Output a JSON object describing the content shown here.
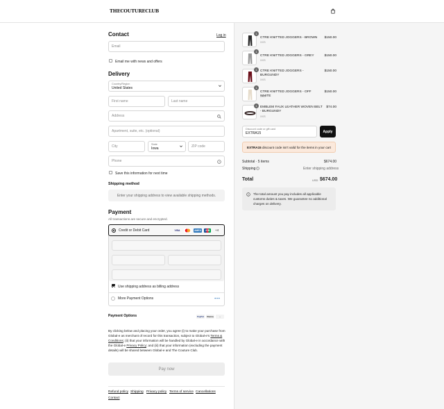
{
  "header": {
    "logo": "THECOUTURECLUB",
    "cart_icon": "shopping-bag-icon"
  },
  "contact": {
    "title": "Contact",
    "login_link": "Log in",
    "email_placeholder": "Email",
    "news_label": "Email me with news and offers"
  },
  "delivery": {
    "title": "Delivery",
    "country_label": "Country/Region",
    "country_value": "United States",
    "first_name": "First name",
    "last_name": "Last name",
    "address": "Address",
    "apartment": "Apartment, suite, etc. (optional)",
    "city": "City",
    "state_label": "State",
    "state_value": "Iowa",
    "zip": "ZIP code",
    "phone": "Phone",
    "save_label": "Save this information for next time"
  },
  "shipping": {
    "title": "Shipping method",
    "notice": "Enter your shipping address to view available shipping methods."
  },
  "payment": {
    "title": "Payment",
    "subtitle": "All transactions are secure and encrypted.",
    "card_label": "Credit or Debit Card",
    "card_logos": [
      "VISA",
      "MC",
      "AMEX",
      "JCB"
    ],
    "more_cards": "+4",
    "billing_label": "Use shipping address as billing address",
    "more_options_label": "More Payment Options",
    "options_title": "Payment Options",
    "option_badges": [
      "PayPal",
      "Klarna",
      "..."
    ]
  },
  "legal": {
    "line1": "By clicking below and placing your order, you agree (i) to make your purchase from",
    "line2a": "Global-e as merchant of record for this transaction, subject to Global-e's ",
    "terms": "Terms &",
    "line3a": "Conditions",
    "line3b": "; (ii) that your information will be handled by Global-e in accordance with",
    "line4a": "the Global-e ",
    "privacy": "Privacy Policy",
    "line4b": "; and (iii) that your information (excluding the payment",
    "line5": "details) will be shared between Global-e and The Couture Club."
  },
  "pay_button": "Pay now",
  "footer": {
    "links": [
      "Refund policy",
      "Shipping",
      "Privacy policy",
      "Terms of service",
      "Cancellations"
    ],
    "contact": "Contact"
  },
  "cart": {
    "items": [
      {
        "name": "CTRE KNITTED JOGGERS - BROWN",
        "size": "XXS",
        "price": "$150.00",
        "qty": "1",
        "color": "#2b2b2b"
      },
      {
        "name": "CTRE KNITTED JOGGERS - GREY",
        "size": "XXS",
        "price": "$150.00",
        "qty": "1",
        "color": "#9a9a9a"
      },
      {
        "name": "CTRE KNITTED JOGGERS - BURGUNDY",
        "size": "XXS",
        "price": "$150.00",
        "qty": "1",
        "color": "#6b0f1a"
      },
      {
        "name": "CTRE KNITTED JOGGERS - OFF WHITE",
        "size": "XXS",
        "price": "$150.00",
        "qty": "1",
        "color": "#e6dccb"
      },
      {
        "name": "EMBLEM FAUX LEATHER WOVEN BELT - BURGUNDY",
        "size": "XXS",
        "price": "$74.00",
        "qty": "1",
        "color": "#3a2a2a"
      }
    ],
    "discount_label": "Discount code or gift card",
    "discount_value": "EXTRA15",
    "apply": "Apply",
    "discount_code": "EXTRA15",
    "discount_error": " discount code isn't valid for the items in your cart",
    "subtotal_label": "Subtotal · 5 items",
    "subtotal_value": "$674.00",
    "shipping_label": "Shipping",
    "shipping_value": "Enter shipping address",
    "total_label": "Total",
    "currency": "USD",
    "total_value": "$674.00",
    "duties_note_1": "The total amount you pay includes all applicable",
    "duties_note_2": "customs duties & taxes. We guarantee no additional",
    "duties_note_3": "charges on delivery."
  }
}
